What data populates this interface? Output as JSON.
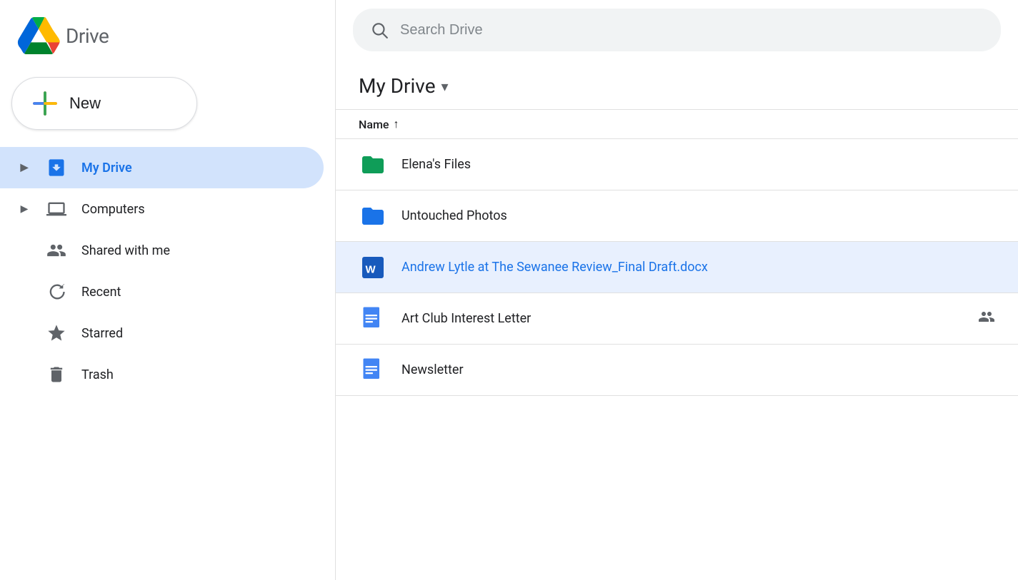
{
  "logo": {
    "text": "Drive"
  },
  "sidebar": {
    "new_label": "New",
    "items": [
      {
        "id": "my-drive",
        "label": "My Drive",
        "icon": "drive",
        "active": true,
        "has_expand": true
      },
      {
        "id": "computers",
        "label": "Computers",
        "icon": "computers",
        "active": false,
        "has_expand": true
      },
      {
        "id": "shared",
        "label": "Shared with me",
        "icon": "shared",
        "active": false,
        "has_expand": false
      },
      {
        "id": "recent",
        "label": "Recent",
        "icon": "recent",
        "active": false,
        "has_expand": false
      },
      {
        "id": "starred",
        "label": "Starred",
        "icon": "starred",
        "active": false,
        "has_expand": false
      },
      {
        "id": "trash",
        "label": "Trash",
        "icon": "trash",
        "active": false,
        "has_expand": false
      }
    ]
  },
  "search": {
    "placeholder": "Search Drive"
  },
  "main": {
    "title": "My Drive",
    "sort_column": "Name",
    "files": [
      {
        "id": 1,
        "name": "Elena's Files",
        "type": "folder-green",
        "selected": false,
        "shared": false
      },
      {
        "id": 2,
        "name": "Untouched Photos",
        "type": "folder-blue",
        "selected": false,
        "shared": false
      },
      {
        "id": 3,
        "name": "Andrew Lytle at The Sewanee Review_Final Draft.docx",
        "type": "word",
        "selected": true,
        "shared": false
      },
      {
        "id": 4,
        "name": "Art Club Interest Letter",
        "type": "doc",
        "selected": false,
        "shared": true
      },
      {
        "id": 5,
        "name": "Newsletter",
        "type": "doc",
        "selected": false,
        "shared": false
      }
    ]
  }
}
